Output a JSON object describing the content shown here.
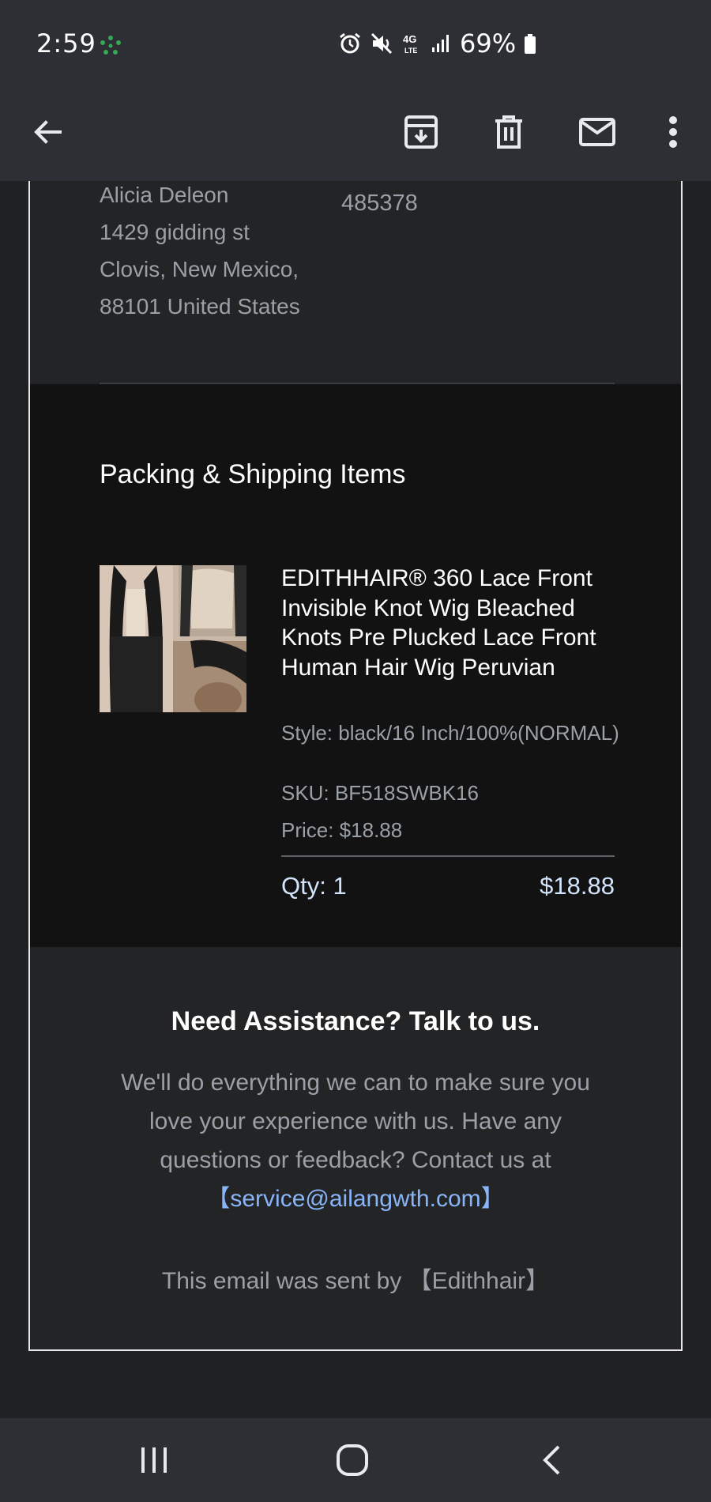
{
  "status_bar": {
    "time": "2:59",
    "battery": "69%"
  },
  "app_bar": {
    "icons": [
      "back-arrow-icon",
      "archive-icon",
      "delete-icon",
      "mark-unread-icon",
      "more-vert-icon"
    ]
  },
  "shipping_address": {
    "lines": [
      "Alicia Deleon",
      "1429 gidding st",
      "Clovis, New Mexico,",
      "88101 United States"
    ]
  },
  "order_number_partial": "485378",
  "items_section": {
    "title": "Packing & Shipping Items",
    "item": {
      "name": "EDITHHAIR® 360 Lace Front Invisible Knot Wig Bleached Knots Pre Plucked Lace Front Human Hair Wig Peruvian",
      "style": "Style: black/16 Inch/100%(NORMAL)",
      "sku": "SKU: BF518SWBK16",
      "price": "Price: $18.88",
      "qty": "Qty: 1",
      "line_total": "$18.88"
    }
  },
  "assistance": {
    "title": "Need Assistance? Talk to us.",
    "body": "We'll do everything we can to make sure you love your experience with us. Have any questions or feedback? Contact us at",
    "email_link": "【service@ailangwth.com】",
    "sent_by": "This email was sent by 【Edithhair】"
  },
  "colors": {
    "app_bar": "#2d2f35",
    "page_bg": "#202124",
    "items_bg": "#121212",
    "link": "#8ab4f8",
    "muted_text": "#9aa0a6"
  }
}
